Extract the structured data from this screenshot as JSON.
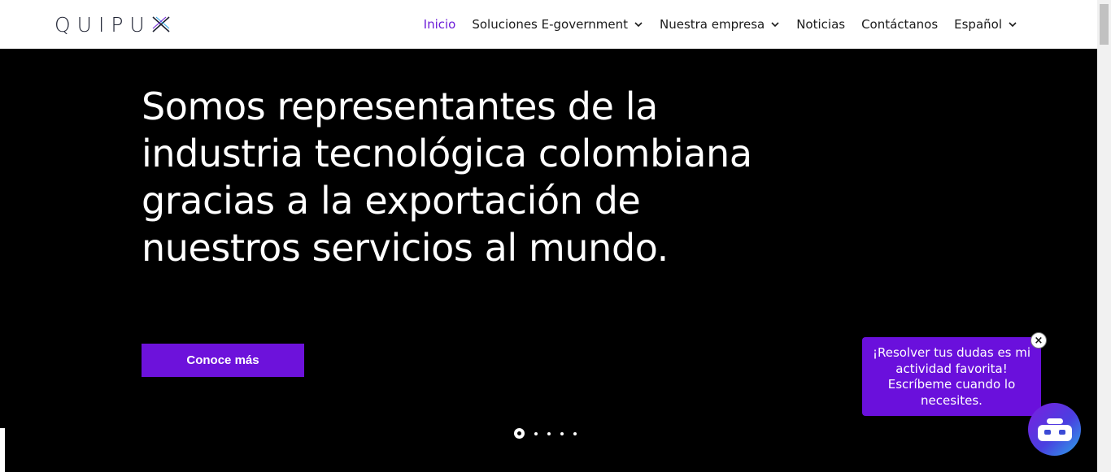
{
  "header": {
    "logo": {
      "text": "QUIPU",
      "mark": "x-logo-icon"
    },
    "nav": [
      {
        "label": "Inicio",
        "active": true,
        "dropdown": false
      },
      {
        "label": "Soluciones E-government",
        "active": false,
        "dropdown": true
      },
      {
        "label": "Nuestra empresa",
        "active": false,
        "dropdown": true
      },
      {
        "label": "Noticias",
        "active": false,
        "dropdown": false
      },
      {
        "label": "Contáctanos",
        "active": false,
        "dropdown": false
      },
      {
        "label": "Español",
        "active": false,
        "dropdown": true
      }
    ]
  },
  "hero": {
    "title_lines": [
      "Somos representantes de la",
      "industria tecnológica colombiana",
      "gracias a la exportación de",
      "nuestros servicios al mundo."
    ],
    "cta_label": "Conoce más",
    "slider": {
      "count": 5,
      "active_index": 0
    }
  },
  "chat": {
    "message": "¡Resolver tus dudas es mi actividad favorita! Escríbeme cuando lo necesites.",
    "close_label": "×",
    "bot_icon": "robot-icon"
  },
  "colors": {
    "accent": "#6d12db",
    "nav_active": "#6d1ed8",
    "hero_bg": "#000000",
    "header_bg": "#ffffff"
  }
}
